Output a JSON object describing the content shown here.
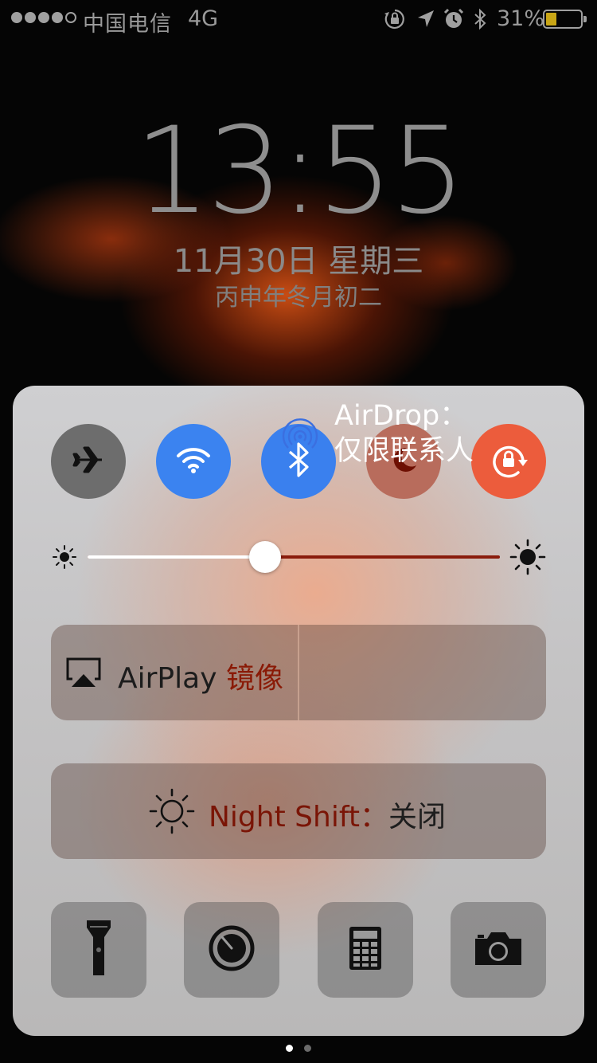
{
  "status_bar": {
    "carrier": "中国电信",
    "network": "4G",
    "battery_percent": "31%",
    "battery_level": 0.31,
    "signal_bars_filled": 4,
    "signal_bars_total": 5,
    "icons": [
      "orientation-lock-icon",
      "location-arrow-icon",
      "alarm-icon",
      "bluetooth-icon",
      "battery-icon"
    ]
  },
  "lock_screen": {
    "time": "13:55",
    "date": "11月30日 星期三",
    "lunar_date": "丙申年冬月初二"
  },
  "control_center": {
    "toggles": [
      {
        "name": "airplane-mode",
        "icon": "airplane-icon",
        "on": false,
        "color": "#6d6d6d"
      },
      {
        "name": "wifi",
        "icon": "wifi-icon",
        "on": true,
        "color": "#3b83f0"
      },
      {
        "name": "bluetooth",
        "icon": "bluetooth-icon",
        "on": true,
        "color": "#3a80ee"
      },
      {
        "name": "do-not-disturb",
        "icon": "moon-icon",
        "on": false,
        "color": "#b86c5c"
      },
      {
        "name": "rotation-lock",
        "icon": "rotation-lock-icon",
        "on": true,
        "color": "#ec5c3c"
      }
    ],
    "brightness": 0.43,
    "airplay": {
      "label": "AirPlay",
      "label_highlight": "镜像"
    },
    "airdrop": {
      "line1": "AirDrop：",
      "line2": "仅限联系人"
    },
    "night_shift": {
      "label": "Night Shift：",
      "state": "关闭"
    },
    "tools": [
      {
        "name": "flashlight",
        "icon": "flashlight-icon"
      },
      {
        "name": "timer",
        "icon": "timer-icon"
      },
      {
        "name": "calculator",
        "icon": "calculator-icon"
      },
      {
        "name": "camera",
        "icon": "camera-icon"
      }
    ]
  },
  "page_indicator": {
    "count": 2,
    "current": 0
  }
}
